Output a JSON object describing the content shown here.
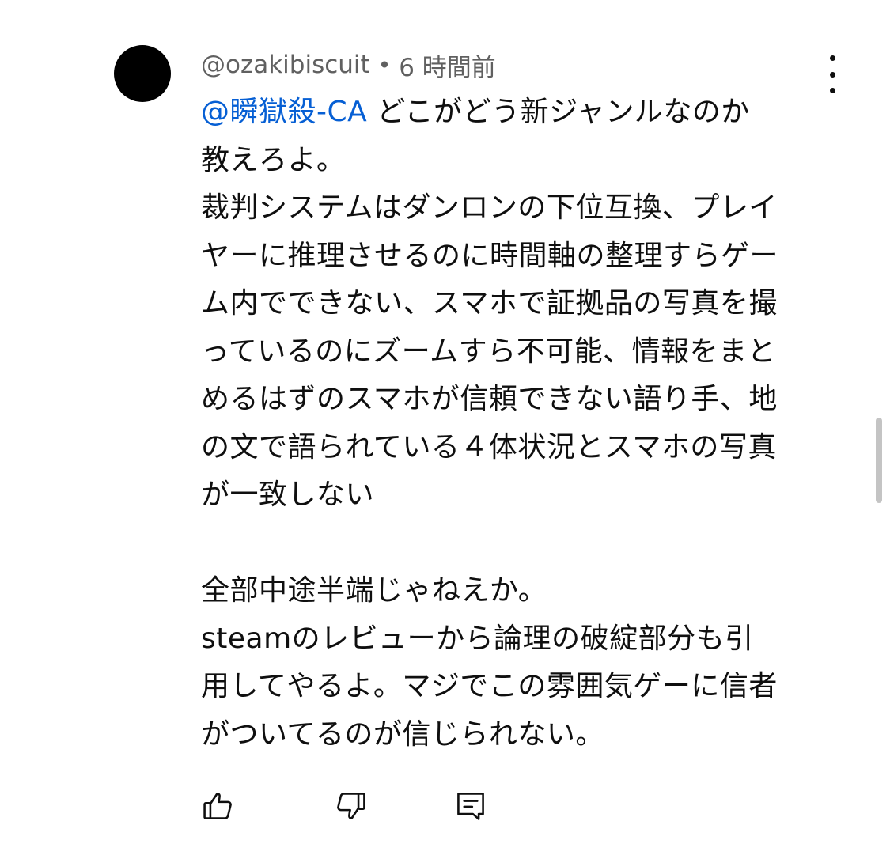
{
  "comment": {
    "author": "@ozakibiscuit",
    "separator": "•",
    "timestamp": "6 時間前",
    "mention": "@瞬獄殺-CA",
    "lines": [
      "どこがどう新ジャンルなのか",
      "教えろよ。",
      "裁判システムはダンロンの下位互換、プレイ",
      "ヤーに推理させるのに時間軸の整理すらゲー",
      "ム内でできない、スマホで証拠品の写真を撮",
      "っているのにズームすら不可能、情報をまと",
      "めるはずのスマホが信頼できない語り手、地",
      "の文で語られている４体状況とスマホの写真",
      "が一致しない",
      "全部中途半端じゃねえか。",
      "steamのレビューから論理の破綻部分も引",
      "用してやるよ。マジでこの雰囲気ゲーに信者",
      "がついてるのが信じられない。"
    ]
  },
  "actions": {
    "like_icon": "thumbs-up-icon",
    "dislike_icon": "thumbs-down-icon",
    "reply_icon": "reply-comment-icon",
    "menu_icon": "more-vertical-icon"
  },
  "colors": {
    "mention": "#065fd4",
    "meta": "#606060",
    "text": "#0f0f0f",
    "avatar": "#000000"
  }
}
